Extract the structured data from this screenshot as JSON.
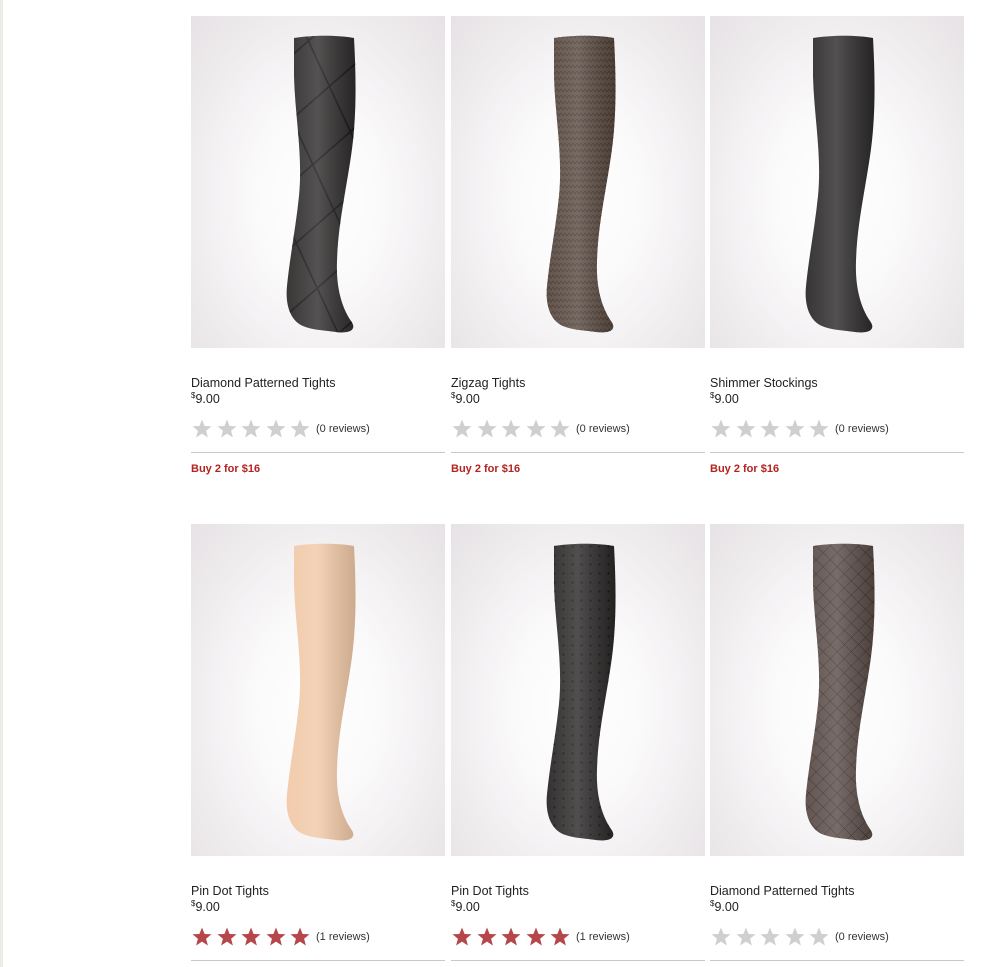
{
  "products": [
    {
      "name": "Diamond Patterned Tights",
      "currency": "$",
      "price": "9.00",
      "rating": 0,
      "reviews": "(0 reviews)",
      "promo": "Buy 2 for $16",
      "image": "diamond-pattern-black-tights-image",
      "leg_color": "#2f2c2c",
      "pattern": "diamond-large"
    },
    {
      "name": "Zigzag Tights",
      "currency": "$",
      "price": "9.00",
      "rating": 0,
      "reviews": "(0 reviews)",
      "promo": "Buy 2 for $16",
      "image": "zigzag-brown-tights-image",
      "leg_color": "#5b4b42",
      "pattern": "zigzag"
    },
    {
      "name": "Shimmer Stockings",
      "currency": "$",
      "price": "9.00",
      "rating": 0,
      "reviews": "(0 reviews)",
      "promo": "Buy 2 for $16",
      "image": "shimmer-black-stockings-image",
      "leg_color": "#2c2a2b",
      "pattern": "none"
    },
    {
      "name": "Pin Dot Tights",
      "currency": "$",
      "price": "9.00",
      "rating": 5,
      "reviews": "(1 reviews)",
      "promo": "",
      "image": "pin-dot-nude-tights-image",
      "leg_color": "#f1c9a8",
      "pattern": "none"
    },
    {
      "name": "Pin Dot Tights",
      "currency": "$",
      "price": "9.00",
      "rating": 5,
      "reviews": "(1 reviews)",
      "promo": "",
      "image": "pin-dot-black-tights-image",
      "leg_color": "#2a2727",
      "pattern": "dots"
    },
    {
      "name": "Diamond Patterned Tights",
      "currency": "$",
      "price": "9.00",
      "rating": 0,
      "reviews": "(0 reviews)",
      "promo": "",
      "image": "diamond-pattern-taupe-tights-image",
      "leg_color": "#5a4c48",
      "pattern": "diamond-small"
    }
  ],
  "colors": {
    "star_filled": "#b5464a",
    "star_empty": "#cfcfcf",
    "promo_text": "#b3231f"
  }
}
